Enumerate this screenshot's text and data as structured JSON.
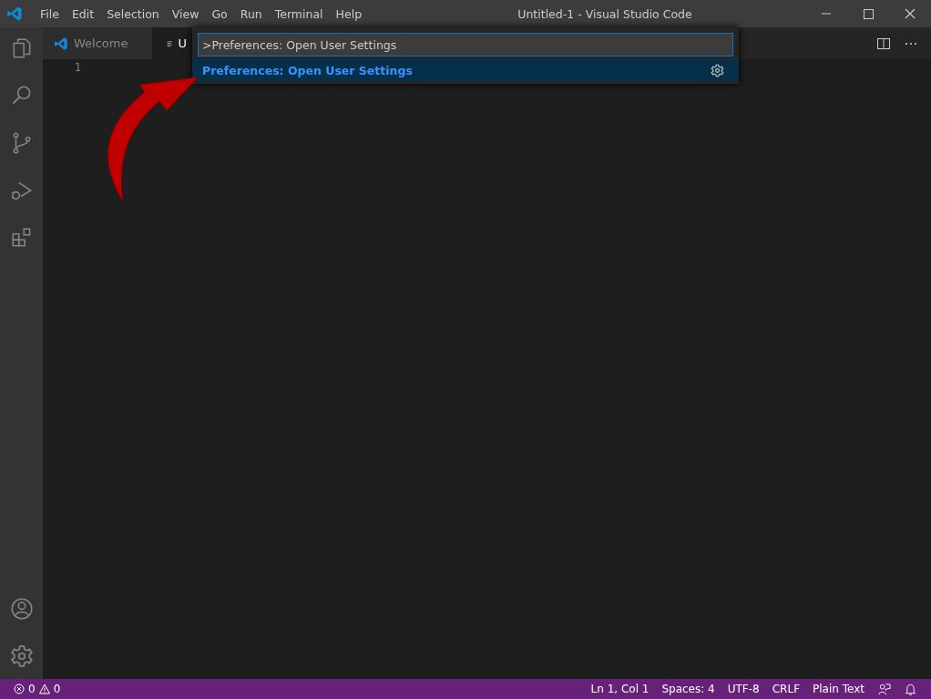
{
  "window": {
    "title": "Untitled-1 - Visual Studio Code"
  },
  "menu": [
    "File",
    "Edit",
    "Selection",
    "View",
    "Go",
    "Run",
    "Terminal",
    "Help"
  ],
  "tabs": [
    {
      "label": "Welcome",
      "selected": false,
      "kind": "welcome"
    },
    {
      "label": "U",
      "selected": true,
      "kind": "file"
    }
  ],
  "editor": {
    "line_numbers": [
      "1"
    ]
  },
  "command_palette": {
    "value": ">Preferences: Open User Settings",
    "results": [
      {
        "label": "Preferences: Open User Settings",
        "selected": true
      }
    ]
  },
  "status_bar": {
    "errors": "0",
    "warnings": "0",
    "items": [
      "Ln 1, Col 1",
      "Spaces: 4",
      "UTF-8",
      "CRLF",
      "Plain Text"
    ]
  }
}
